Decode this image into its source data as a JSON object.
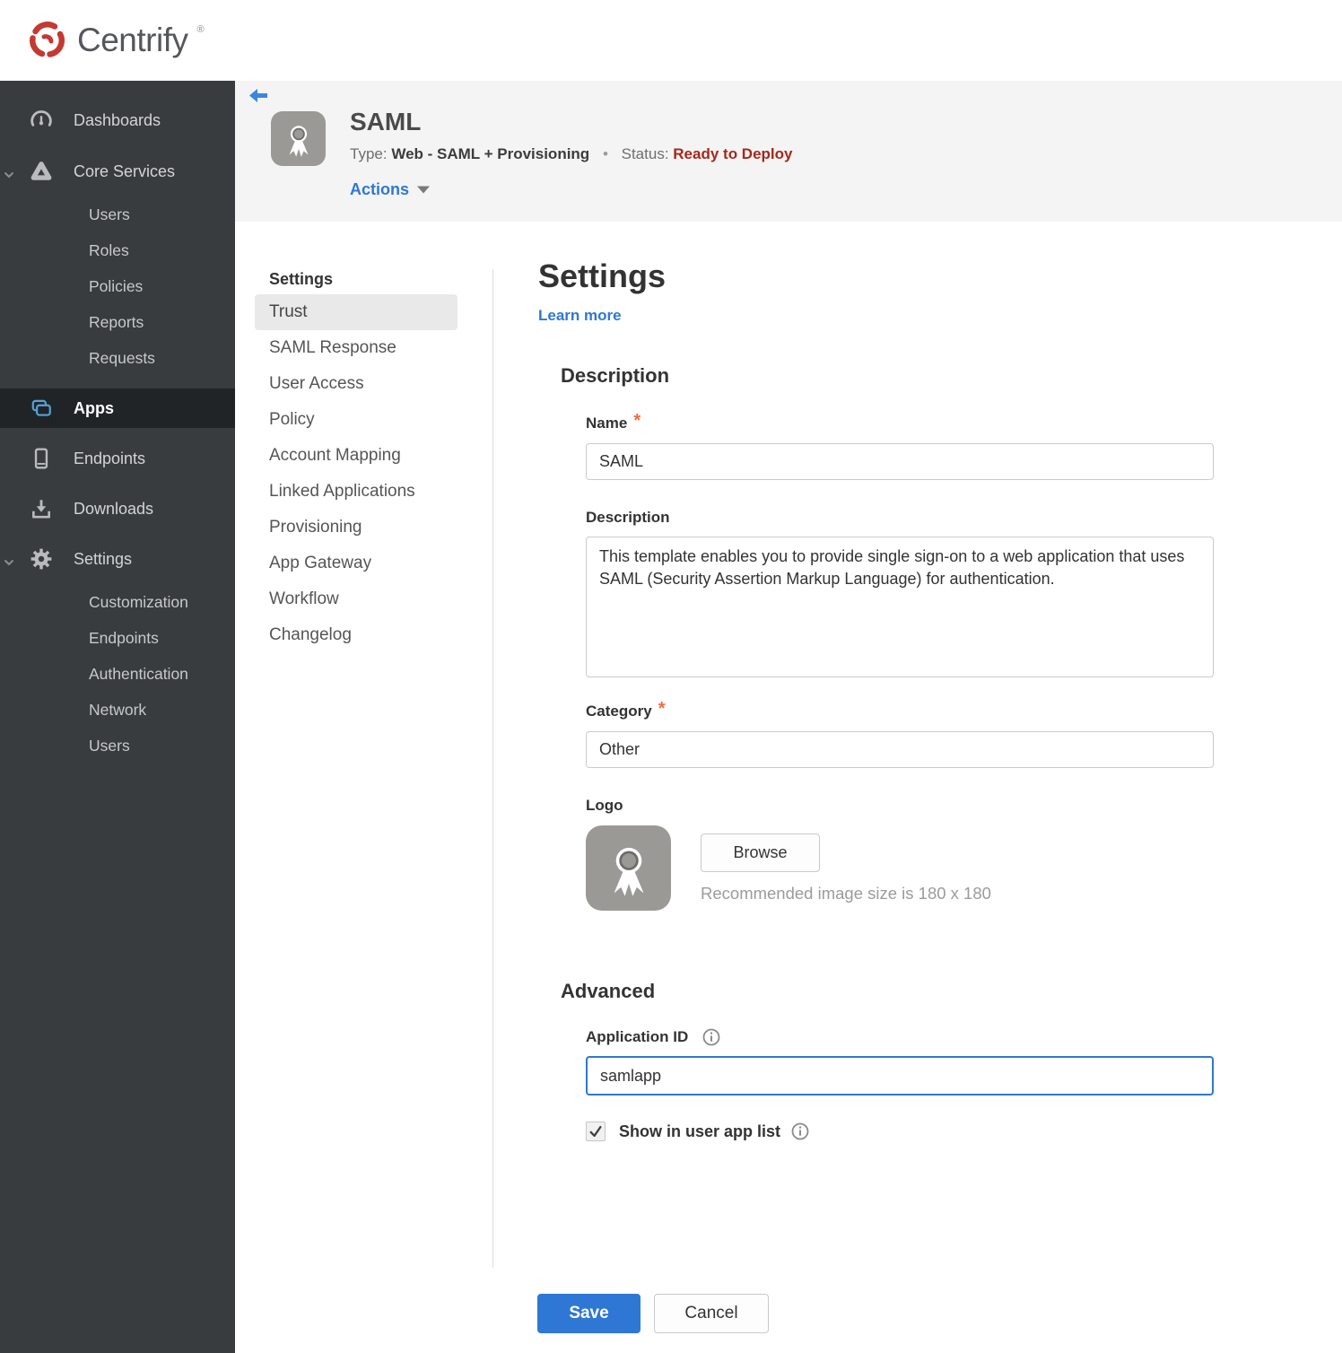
{
  "brand": {
    "name": "Centrify",
    "registered": "®"
  },
  "sidebar": {
    "dashboards": "Dashboards",
    "core_services": "Core Services",
    "core_children": [
      "Users",
      "Roles",
      "Policies",
      "Reports",
      "Requests"
    ],
    "apps": "Apps",
    "endpoints": "Endpoints",
    "downloads": "Downloads",
    "settings": "Settings",
    "settings_children": [
      "Customization",
      "Endpoints",
      "Authentication",
      "Network",
      "Users"
    ]
  },
  "header": {
    "title": "SAML",
    "type_label": "Type:",
    "type_value": "Web - SAML + Provisioning",
    "bullet": "•",
    "status_label": "Status:",
    "status_value": "Ready to Deploy",
    "actions_label": "Actions"
  },
  "subnav": {
    "heading": "Settings",
    "selected": "Trust",
    "items": [
      "Trust",
      "SAML Response",
      "User Access",
      "Policy",
      "Account Mapping",
      "Linked Applications",
      "Provisioning",
      "App Gateway",
      "Workflow",
      "Changelog"
    ]
  },
  "main": {
    "title": "Settings",
    "learn_more": "Learn more",
    "description_section": {
      "heading": "Description",
      "name_label": "Name",
      "name_value": "SAML",
      "description_label": "Description",
      "description_value": "This template enables you to provide single sign-on to a web application that uses SAML (Security Assertion Markup Language) for authentication.",
      "category_label": "Category",
      "category_value": "Other",
      "logo_label": "Logo",
      "browse_label": "Browse",
      "logo_hint": "Recommended image size is 180 x 180"
    },
    "advanced_section": {
      "heading": "Advanced",
      "app_id_label": "Application ID",
      "app_id_value": "samlapp",
      "show_in_app_list_label": "Show in user app list",
      "checkbox_checked": true
    },
    "save_label": "Save",
    "cancel_label": "Cancel"
  },
  "colors": {
    "accent_blue": "#2e77d4",
    "status_red": "#a5281c",
    "required_orange": "#ed6d3a",
    "sidebar_bg": "#383c3f",
    "sidebar_active_bg": "#212426",
    "header_band_bg": "#f4f4f4",
    "app_icon_gray": "#9b9996",
    "logo_red": "#c23a32"
  }
}
